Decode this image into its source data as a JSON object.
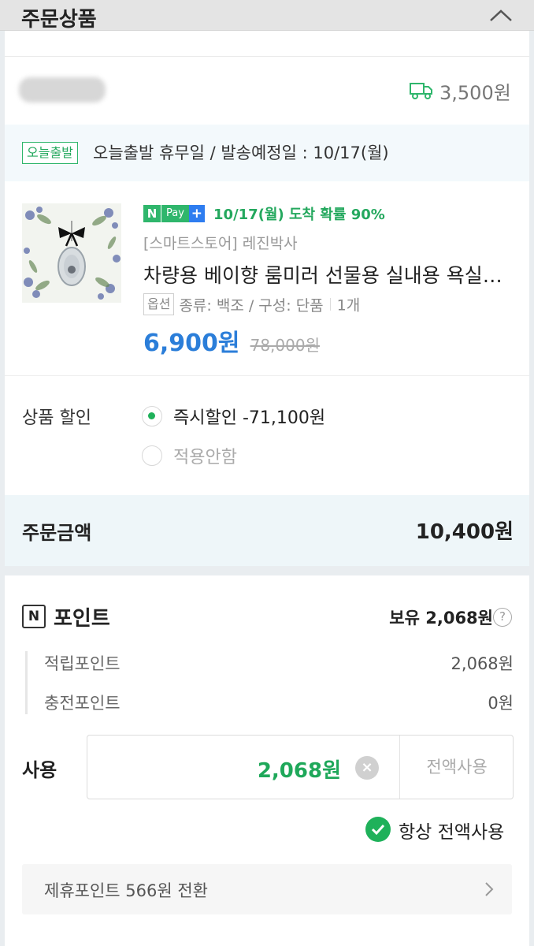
{
  "header": {
    "title": "주문상품",
    "collapse_icon": "chevron-up-icon"
  },
  "seller": {
    "shipping_fee": "3,500원",
    "shipping_icon": "truck-icon"
  },
  "dispatch": {
    "badge": "오늘출발",
    "text": "오늘출발 휴무일 / 발송예정일 : 10/17(월)"
  },
  "product": {
    "npay_n": "N",
    "npay_pay": "Pay",
    "npay_plus": "+",
    "arrival": "10/17(월) 도착 확률 90%",
    "store": "[스마트스토어] 레진박사",
    "name": "차량용 베이향 룸미러 선물용 실내용 욕실용 방향제",
    "option_badge": "옵션",
    "option_text": "종류: 백조 / 구성: 단품",
    "quantity": "1개",
    "price": "6,900원",
    "original_price": "78,000원"
  },
  "discount": {
    "label": "상품 할인",
    "option_instant": "즉시할인 -71,100원",
    "option_none": "적용안함",
    "selected": "즉시할인 -71,100원"
  },
  "total": {
    "label": "주문금액",
    "value": "10,400원"
  },
  "points": {
    "icon_letter": "N",
    "title": "포인트",
    "holding": "보유 2,068원",
    "help": "?",
    "earned_label": "적립포인트",
    "earned_value": "2,068원",
    "charged_label": "충전포인트",
    "charged_value": "0원",
    "use_label": "사용",
    "use_value": "2,068원",
    "clear": "×",
    "use_all": "전액사용",
    "always_use_all": "항상 전액사용",
    "always_checked": true,
    "convert_text": "제휴포인트 566원 전환"
  },
  "colors": {
    "accent_green": "#1fb15a",
    "price_blue": "#2b7ed9",
    "npay_green": "#2fb66c",
    "plus_blue": "#2e7df0"
  }
}
